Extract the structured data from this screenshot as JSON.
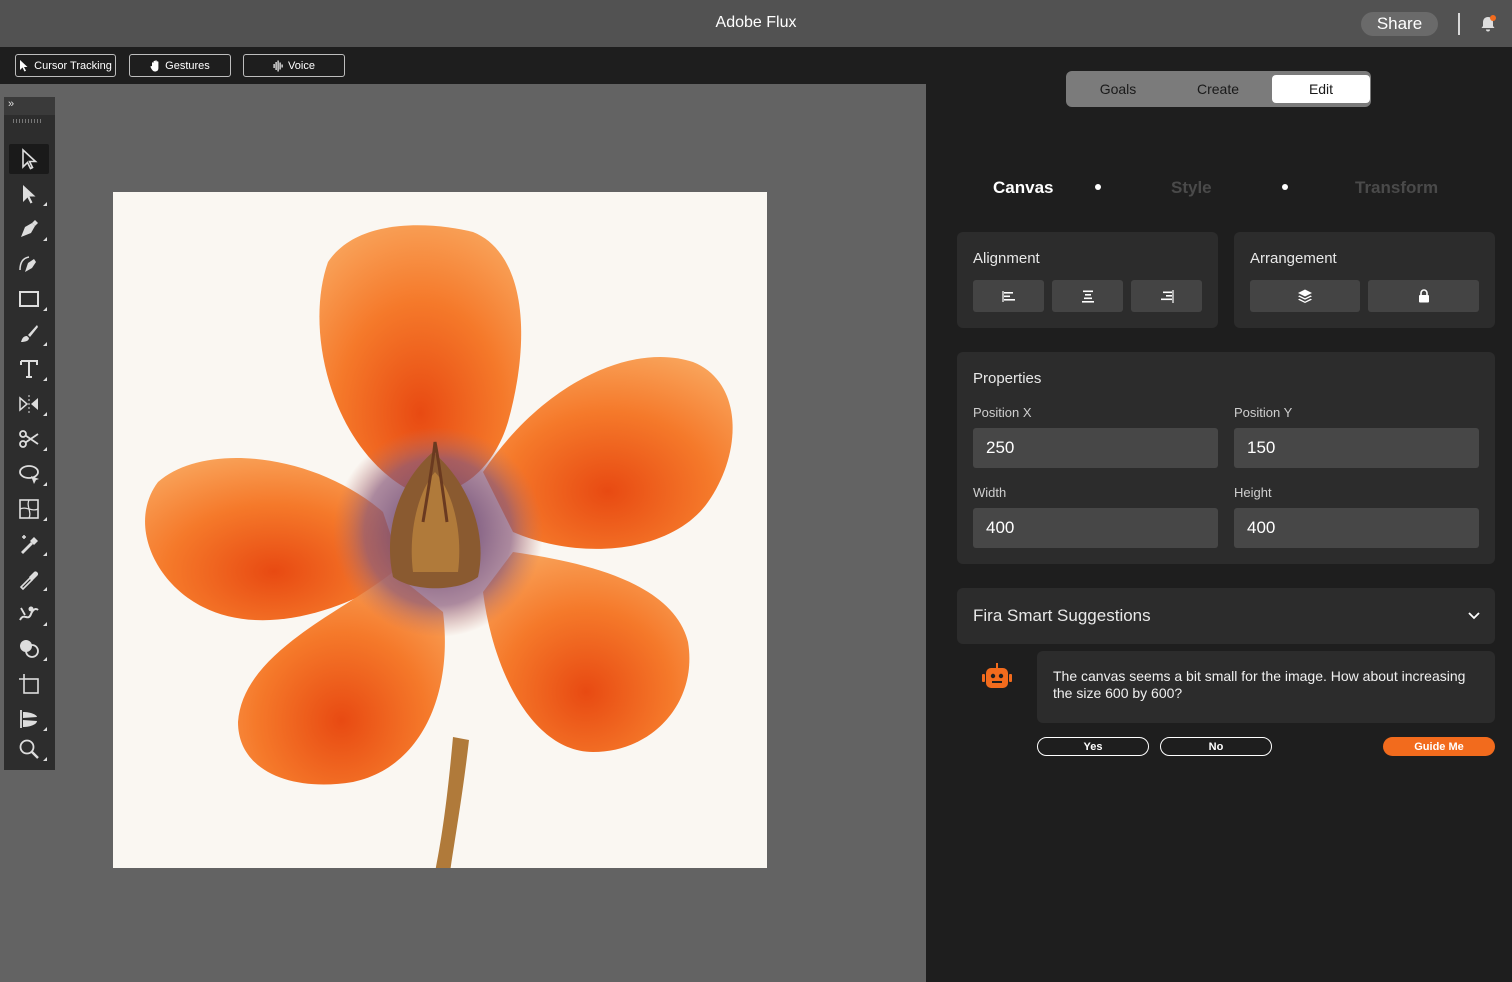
{
  "window": {
    "title": "Adobe Flux",
    "share_label": "Share"
  },
  "modes": [
    {
      "label": "Cursor Tracking",
      "icon": "cursor-icon"
    },
    {
      "label": "Gestures",
      "icon": "hand-icon"
    },
    {
      "label": "Voice",
      "icon": "waveform-icon"
    }
  ],
  "toolbar": {
    "expand_label": "»",
    "tools": [
      "selection-tool",
      "direct-selection-tool",
      "pen-tool",
      "curvature-tool",
      "rectangle-tool",
      "paintbrush-tool",
      "type-tool",
      "reflect-tool",
      "scissors-tool",
      "lasso-tool",
      "mesh-tool",
      "eyedropper-plus-tool",
      "eyedropper-tool",
      "puppet-warp-tool",
      "shape-builder-tool",
      "artboard-tool",
      "width-tool",
      "zoom-tool"
    ],
    "active_tool": "selection-tool"
  },
  "panel": {
    "segments": [
      "Goals",
      "Create",
      "Edit"
    ],
    "active_segment": "Edit",
    "subtabs": [
      "Canvas",
      "Style",
      "Transform"
    ],
    "active_subtab": "Canvas",
    "alignment": {
      "title": "Alignment"
    },
    "arrangement": {
      "title": "Arrangement"
    },
    "properties": {
      "title": "Properties",
      "position_x_label": "Position X",
      "position_x": "250",
      "position_y_label": "Position Y",
      "position_y": "150",
      "width_label": "Width",
      "width": "400",
      "height_label": "Height",
      "height": "400"
    },
    "suggestions": {
      "title": "Fira Smart Suggestions",
      "message": "The canvas seems a bit small for the image. How about increasing the size 600 by 600?",
      "yes_label": "Yes",
      "no_label": "No",
      "guide_label": "Guide Me"
    }
  },
  "colors": {
    "accent": "#f26b1d",
    "panel_bg": "#1e1e1e",
    "canvas_bg": "#636363"
  }
}
